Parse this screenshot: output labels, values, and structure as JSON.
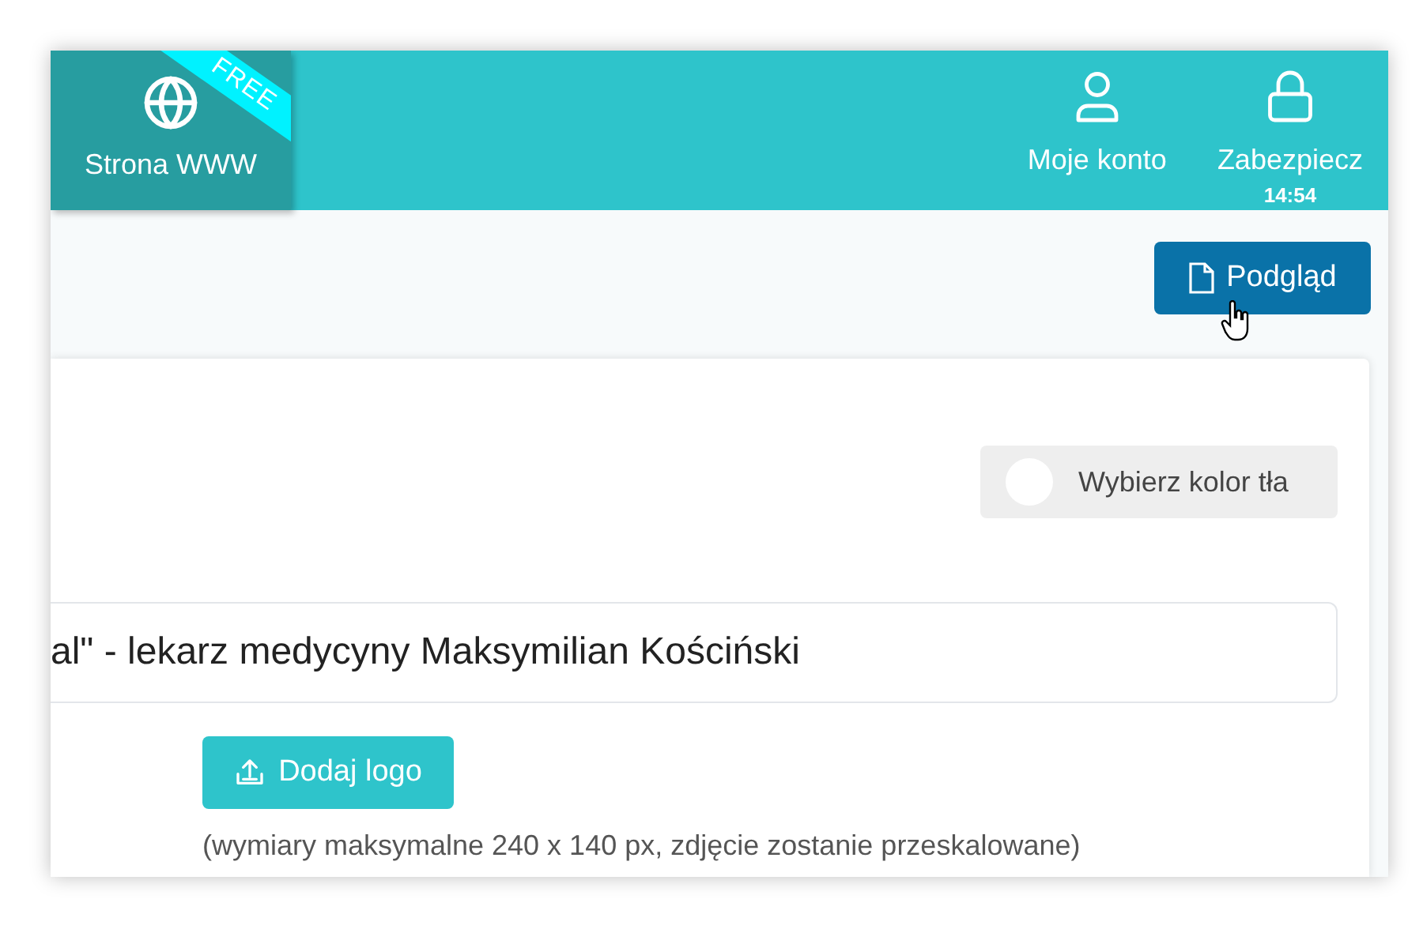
{
  "header": {
    "nav": [
      {
        "label": "Strona WWW",
        "kind": "globe",
        "selected": true,
        "badge": "FREE"
      }
    ],
    "account": [
      {
        "label": "Moje konto",
        "kind": "user"
      },
      {
        "label": "Zabezpiecz",
        "kind": "lock",
        "sublabel": "14:54"
      }
    ]
  },
  "toolbar": {
    "preview_button": "Podgląd"
  },
  "card": {
    "color_button": {
      "label": "Wybierz kolor tła",
      "color": "#ffffff"
    },
    "title_field": {
      "value": "al\" - lekarz medycyny Maksymilian Kościński"
    },
    "logo_button": "Dodaj logo",
    "logo_hint": "(wymiary maksymalne 240 x 140 px, zdjęcie zostanie przeskalowane)"
  }
}
